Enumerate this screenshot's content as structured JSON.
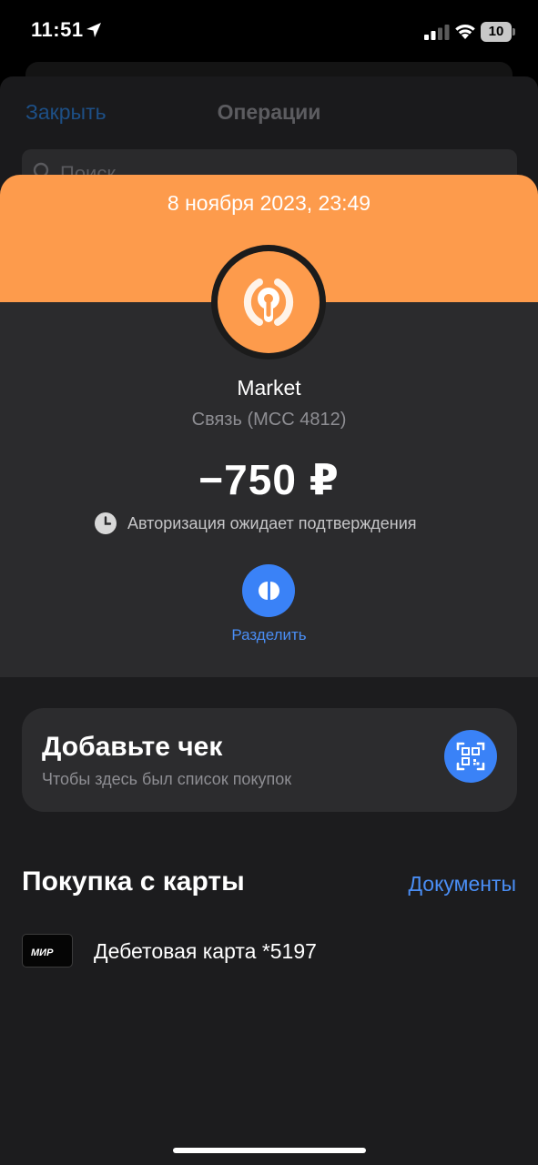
{
  "status_bar": {
    "time": "11:51",
    "battery": "10"
  },
  "background_screen": {
    "close_label": "Закрыть",
    "title": "Операции",
    "search_placeholder": "Поиск"
  },
  "transaction": {
    "date": "8 ноября 2023, 23:49",
    "merchant": "Market",
    "category": "Связь (MCC 4812)",
    "amount": "−750 ₽",
    "status": "Авторизация ожидает подтверждения",
    "split_label": "Разделить"
  },
  "receipt": {
    "title": "Добавьте чек",
    "subtitle": "Чтобы здесь был список покупок"
  },
  "card_section": {
    "title": "Покупка с карты",
    "documents_link": "Документы",
    "card_label": "Дебетовая карта *5197",
    "card_brand": "МИР"
  },
  "colors": {
    "accent_orange": "#fd9b4c",
    "accent_blue": "#3a82f7",
    "link_blue": "#4a8ef5"
  },
  "icons": [
    "location-arrow-icon",
    "signal-icon",
    "wifi-icon",
    "battery-icon",
    "merchant-logo-icon",
    "clock-icon",
    "split-icon",
    "qr-scan-icon",
    "card-icon"
  ]
}
